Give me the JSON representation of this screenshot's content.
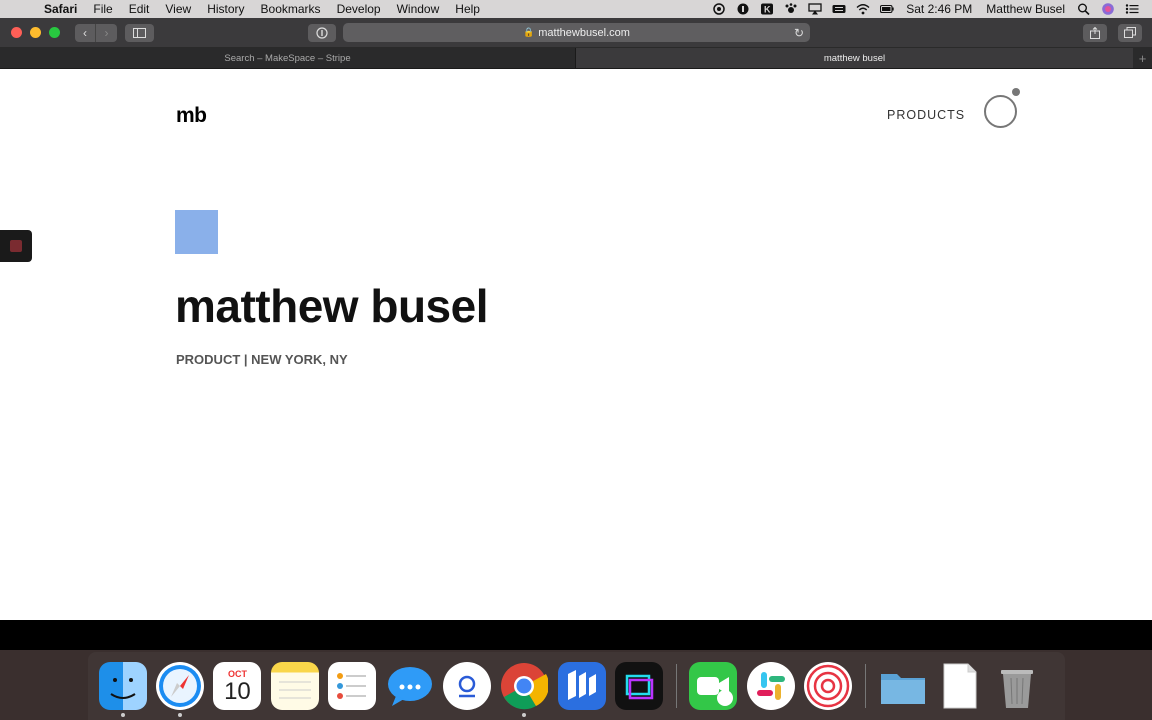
{
  "menubar": {
    "app": "Safari",
    "menus": [
      "File",
      "Edit",
      "View",
      "History",
      "Bookmarks",
      "Develop",
      "Window",
      "Help"
    ],
    "clock": "Sat 2:46 PM",
    "user": "Matthew Busel"
  },
  "browser": {
    "url": "matthewbusel.com",
    "tabs": [
      {
        "title": "Search – MakeSpace – Stripe",
        "active": false
      },
      {
        "title": "matthew busel",
        "active": true
      }
    ]
  },
  "site": {
    "logo": "mb",
    "nav_products": "PRODUCTS",
    "name": "matthew busel",
    "tagline": "PRODUCT | NEW YORK, NY",
    "accent_color": "#8ab0ea"
  },
  "dock": {
    "calendar_month": "OCT",
    "calendar_day": "10"
  }
}
